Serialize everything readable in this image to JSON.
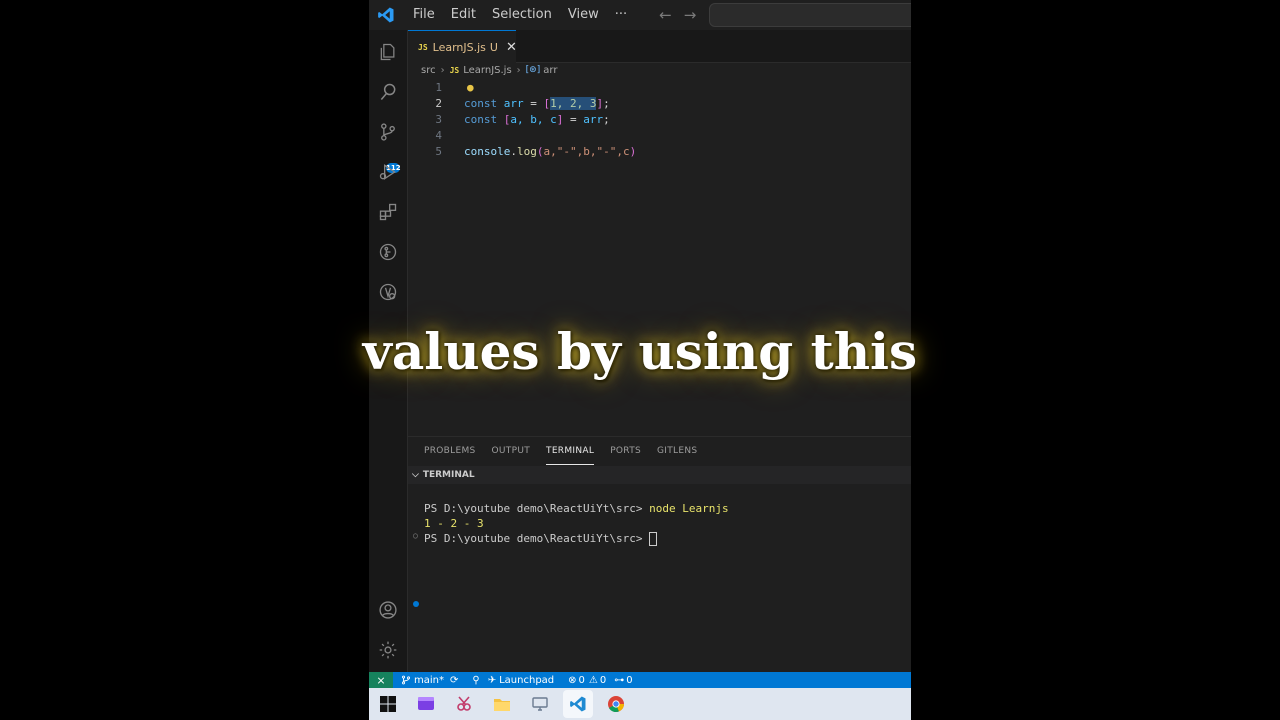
{
  "titlebar": {
    "menus": [
      "File",
      "Edit",
      "Selection",
      "View",
      "···"
    ],
    "back": "←",
    "forward": "→"
  },
  "activity": {
    "source_control_badge": "112"
  },
  "tab": {
    "lang_badge": "JS",
    "filename": "LearnJS.js",
    "status": "U",
    "close": "✕"
  },
  "breadcrumb": {
    "folder": "src",
    "file_badge": "JS",
    "file": "LearnJS.js",
    "symbol_icon": "[⊛]",
    "symbol": "arr"
  },
  "editor": {
    "line_numbers": [
      "1",
      "2",
      "3",
      "4",
      "5"
    ],
    "line2": {
      "kw": "const",
      "name": "arr",
      "eq": "=",
      "open": "[",
      "values": "1, 2, 3",
      "close": "]",
      "semi": ";"
    },
    "line3": {
      "kw": "const",
      "open": "[",
      "names": "a, b, c",
      "close": "]",
      "eq": "=",
      "ref": "arr",
      "semi": ";"
    },
    "line5": {
      "obj": "console",
      "dot": ".",
      "fn": "log",
      "args_open": "(",
      "args": "a,\"-\",b,\"-\",c",
      "args_close": ")"
    }
  },
  "panel": {
    "tabs": [
      "PROBLEMS",
      "OUTPUT",
      "TERMINAL",
      "PORTS",
      "GITLENS"
    ],
    "active_tab": "TERMINAL",
    "section_title": "TERMINAL",
    "terminal": {
      "prompt1": "PS D:\\youtube demo\\ReactUiYt\\src>",
      "command1": "node Learnjs",
      "output": "1 - 2 - 3",
      "prompt2": "PS D:\\youtube demo\\ReactUiYt\\src>"
    }
  },
  "statusbar": {
    "branch": "main*",
    "launchpad": "Launchpad",
    "errors": "0",
    "warnings": "0",
    "ports": "0"
  },
  "caption": "values by using this",
  "colors": {
    "accent": "#0078d4",
    "editor_bg": "#1f1f1f",
    "keyword": "#569cd6",
    "selection": "#264f78"
  }
}
